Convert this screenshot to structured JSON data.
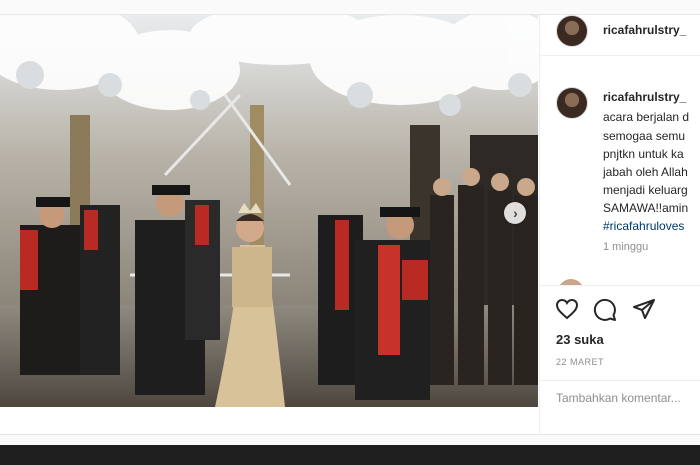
{
  "post": {
    "username": "ricafahrulstry_",
    "caption": {
      "username": "ricafahrulstry_",
      "lines": [
        "acara berjalan d",
        "semogaa semu",
        "pnjtkn untuk ka",
        "jabah oleh Allah",
        "menjadi keluarg",
        "SAMAWA!!amin"
      ],
      "hashtag": "#ricafahruloves"
    },
    "time_ago": "1 minggu",
    "likes": "23 suka",
    "date": "22 MARET",
    "comment_placeholder": "Tambahkan komentar...",
    "next_icon": "chevron-right",
    "icons": [
      "heart-icon",
      "comment-icon",
      "share-icon"
    ]
  }
}
